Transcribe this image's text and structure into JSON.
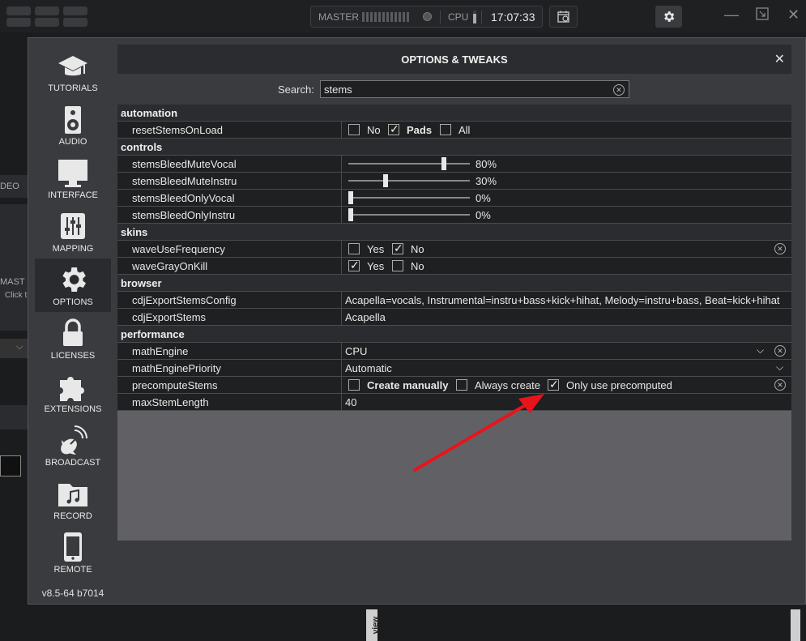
{
  "topbar": {
    "master_label": "MASTER",
    "cpu_label": "CPU",
    "clock": "17:07:33"
  },
  "background": {
    "deck_tab": "DEO",
    "master_text": "MAST",
    "click_text": "Click t",
    "side_tab": "view"
  },
  "dialog": {
    "title": "OPTIONS & TWEAKS",
    "search_label": "Search:",
    "search_value": "stems",
    "version": "v8.5-64 b7014",
    "sidebar": [
      {
        "label": "TUTORIALS",
        "icon": "graduation-cap-icon"
      },
      {
        "label": "AUDIO",
        "icon": "speaker-icon"
      },
      {
        "label": "INTERFACE",
        "icon": "monitor-icon"
      },
      {
        "label": "MAPPING",
        "icon": "sliders-icon"
      },
      {
        "label": "OPTIONS",
        "icon": "gear-icon"
      },
      {
        "label": "LICENSES",
        "icon": "lock-icon"
      },
      {
        "label": "EXTENSIONS",
        "icon": "puzzle-icon"
      },
      {
        "label": "BROADCAST",
        "icon": "satellite-dish-icon"
      },
      {
        "label": "RECORD",
        "icon": "music-folder-icon"
      },
      {
        "label": "REMOTE",
        "icon": "phone-icon"
      }
    ],
    "sections": {
      "automation": "automation",
      "controls": "controls",
      "skins": "skins",
      "browser": "browser",
      "performance": "performance"
    },
    "rows": {
      "resetStemsOnLoad": {
        "name": "resetStemsOnLoad",
        "opt1": "No",
        "opt2": "Pads",
        "opt3": "All"
      },
      "stemsBleedMuteVocal": {
        "name": "stemsBleedMuteVocal",
        "value": "80%",
        "level": 0.8
      },
      "stemsBleedMuteInstru": {
        "name": "stemsBleedMuteInstru",
        "value": "30%",
        "level": 0.3
      },
      "stemsBleedOnlyVocal": {
        "name": "stemsBleedOnlyVocal",
        "value": "0%",
        "level": 0
      },
      "stemsBleedOnlyInstru": {
        "name": "stemsBleedOnlyInstru",
        "value": "0%",
        "level": 0
      },
      "waveUseFrequency": {
        "name": "waveUseFrequency",
        "opt1": "Yes",
        "opt2": "No"
      },
      "waveGrayOnKill": {
        "name": "waveGrayOnKill",
        "opt1": "Yes",
        "opt2": "No"
      },
      "cdjExportStemsConfig": {
        "name": "cdjExportStemsConfig",
        "value": "Acapella=vocals, Instrumental=instru+bass+kick+hihat, Melody=instru+bass, Beat=kick+hihat"
      },
      "cdjExportStems": {
        "name": "cdjExportStems",
        "value": "Acapella"
      },
      "mathEngine": {
        "name": "mathEngine",
        "value": "CPU"
      },
      "mathEnginePriority": {
        "name": "mathEnginePriority",
        "value": "Automatic"
      },
      "precomputeStems": {
        "name": "precomputeStems",
        "opt1": "Create manually",
        "opt2": "Always create",
        "opt3": "Only use precomputed"
      },
      "maxStemLength": {
        "name": "maxStemLength",
        "value": "40"
      }
    }
  },
  "colors": {
    "arrow": "#e8141c",
    "panel_bg": "#616165",
    "row_bg": "#1f2022"
  }
}
